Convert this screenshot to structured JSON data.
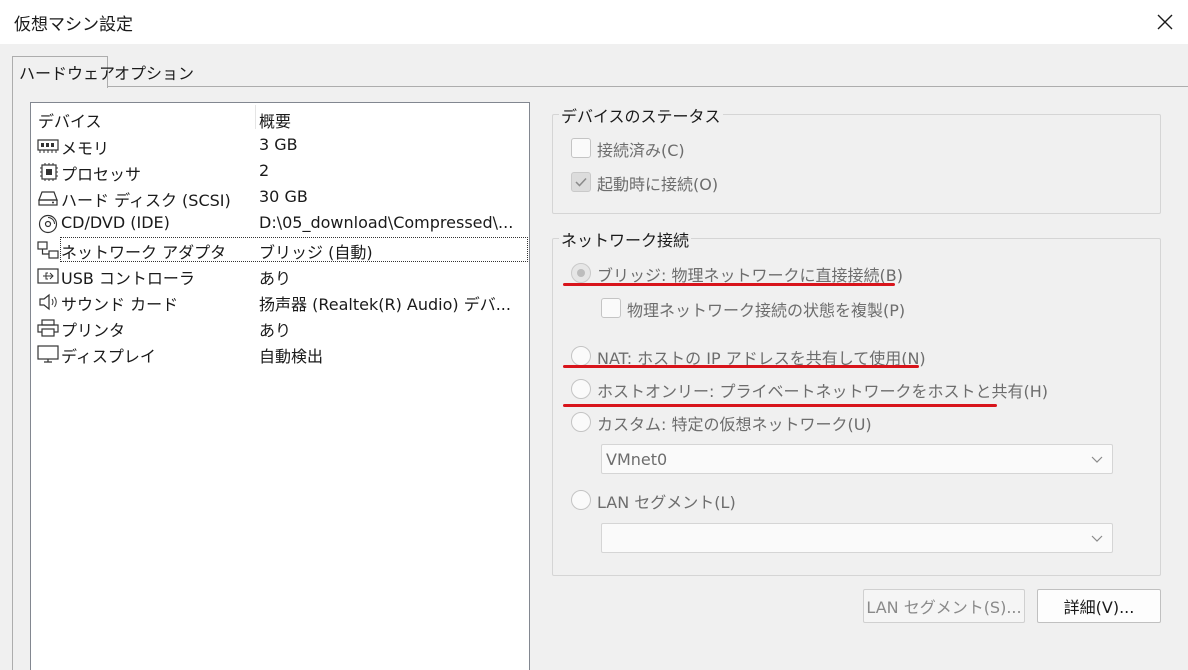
{
  "window": {
    "title": "仮想マシン設定"
  },
  "tabs": [
    {
      "label": "ハードウェア",
      "active": true
    },
    {
      "label": "オプション",
      "active": false
    }
  ],
  "device_list": {
    "columns": [
      "デバイス",
      "概要"
    ],
    "rows": [
      {
        "icon": "memory-icon",
        "name": "メモリ",
        "summary": "3 GB"
      },
      {
        "icon": "processor-icon",
        "name": "プロセッサ",
        "summary": "2"
      },
      {
        "icon": "hard-disk-icon",
        "name": "ハード ディスク (SCSI)",
        "summary": "30 GB"
      },
      {
        "icon": "cd-dvd-icon",
        "name": "CD/DVD (IDE)",
        "summary": "D:\\05_download\\Compressed\\..."
      },
      {
        "icon": "network-adapter-icon",
        "name": "ネットワーク アダプタ",
        "summary": "ブリッジ (自動)",
        "selected": true
      },
      {
        "icon": "usb-icon",
        "name": "USB コントローラ",
        "summary": "あり"
      },
      {
        "icon": "sound-icon",
        "name": "サウンド カード",
        "summary": "扬声器 (Realtek(R) Audio) デバ..."
      },
      {
        "icon": "printer-icon",
        "name": "プリンタ",
        "summary": "あり"
      },
      {
        "icon": "display-icon",
        "name": "ディスプレイ",
        "summary": "自動検出"
      }
    ]
  },
  "device_status": {
    "title": "デバイスのステータス",
    "connected_label": "接続済み(C)",
    "connect_at_power_on_label": "起動時に接続(O)"
  },
  "network": {
    "title": "ネットワーク接続",
    "bridged_label": "ブリッジ: 物理ネットワークに直接接続(B)",
    "replicate_label": "物理ネットワーク接続の状態を複製(P)",
    "nat_label": "NAT: ホストの IP アドレスを共有して使用(N)",
    "host_only_label": "ホストオンリー: プライベートネットワークをホストと共有(H)",
    "custom_label": "カスタム: 特定の仮想ネットワーク(U)",
    "custom_network_value": "VMnet0",
    "lan_segment_label": "LAN セグメント(L)",
    "lan_segment_value": ""
  },
  "buttons": {
    "lan_segments": "LAN セグメント(S)...",
    "advanced": "詳細(V)..."
  },
  "colors": {
    "highlight_underline": "#d8141b"
  }
}
